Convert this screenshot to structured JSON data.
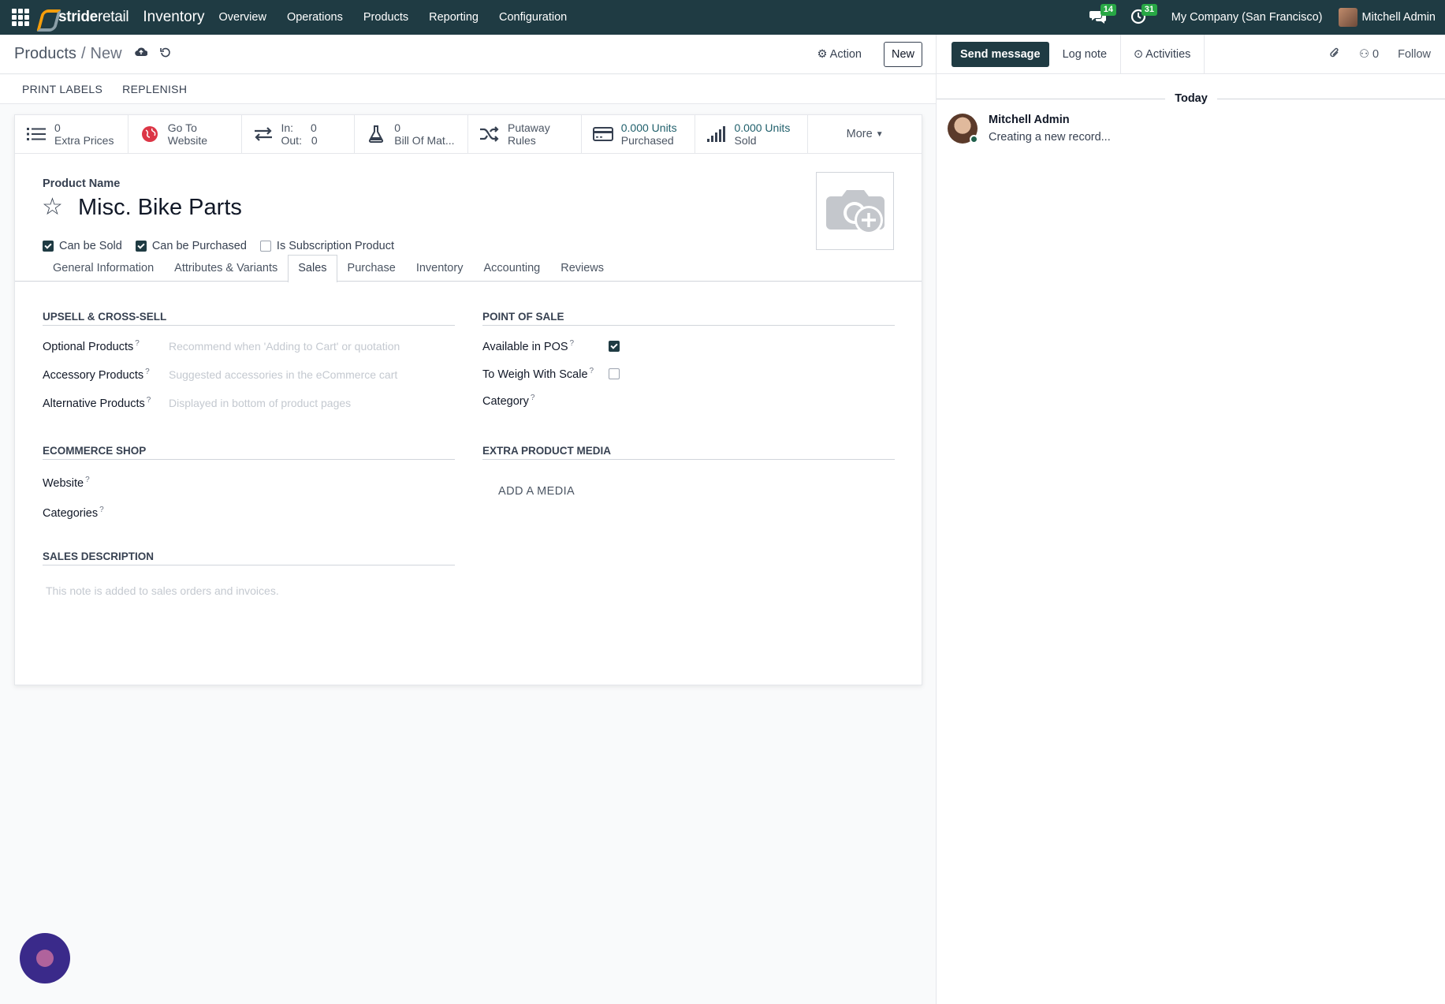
{
  "navbar": {
    "brand_part1": "stride",
    "brand_part2": "retail",
    "app_name": "Inventory",
    "menu": [
      "Overview",
      "Operations",
      "Products",
      "Reporting",
      "Configuration"
    ],
    "messages_count": "14",
    "activities_count": "31",
    "company": "My Company (San Francisco)",
    "user": "Mitchell Admin"
  },
  "control": {
    "breadcrumb_parent": "Products",
    "breadcrumb_sep": "/",
    "breadcrumb_current": "New",
    "action_label": "Action",
    "new_label": "New"
  },
  "status_buttons": [
    "PRINT LABELS",
    "REPLENISH"
  ],
  "smart_buttons": {
    "extra_prices": {
      "value": "0",
      "label": "Extra Prices"
    },
    "website": {
      "line1": "Go To",
      "line2": "Website"
    },
    "in_out": {
      "in_label": "In:",
      "in_value": "0",
      "out_label": "Out:",
      "out_value": "0"
    },
    "bom": {
      "value": "0",
      "label": "Bill Of Mat..."
    },
    "putaway": {
      "line1": "Putaway",
      "line2": "Rules"
    },
    "purchased": {
      "value": "0.000 Units",
      "label": "Purchased"
    },
    "sold": {
      "value": "0.000 Units",
      "label": "Sold"
    },
    "more": "More"
  },
  "form": {
    "product_name_label": "Product Name",
    "product_name": "Misc. Bike Parts",
    "can_be_sold": {
      "label": "Can be Sold",
      "checked": true
    },
    "can_be_purchased": {
      "label": "Can be Purchased",
      "checked": true
    },
    "is_subscription": {
      "label": "Is Subscription Product",
      "checked": false
    }
  },
  "tabs": [
    "General Information",
    "Attributes & Variants",
    "Sales",
    "Purchase",
    "Inventory",
    "Accounting",
    "Reviews"
  ],
  "active_tab": "Sales",
  "sales": {
    "upsell": {
      "title": "UPSELL & CROSS-SELL",
      "optional_label": "Optional Products",
      "optional_placeholder": "Recommend when 'Adding to Cart' or quotation",
      "accessory_label": "Accessory Products",
      "accessory_placeholder": "Suggested accessories in the eCommerce cart",
      "alternative_label": "Alternative Products",
      "alternative_placeholder": "Displayed in bottom of product pages"
    },
    "pos": {
      "title": "POINT OF SALE",
      "available_label": "Available in POS",
      "available_checked": true,
      "weigh_label": "To Weigh With Scale",
      "weigh_checked": false,
      "category_label": "Category"
    },
    "ecommerce": {
      "title": "ECOMMERCE SHOP",
      "website_label": "Website",
      "categories_label": "Categories"
    },
    "media": {
      "title": "EXTRA PRODUCT MEDIA",
      "add_label": "ADD A MEDIA"
    },
    "description": {
      "title": "SALES DESCRIPTION",
      "placeholder": "This note is added to sales orders and invoices."
    }
  },
  "chatter": {
    "send_message": "Send message",
    "log_note": "Log note",
    "activities": "Activities",
    "followers_count": "0",
    "follow": "Follow",
    "today": "Today",
    "message_author": "Mitchell Admin",
    "message_body": "Creating a new record..."
  },
  "colors": {
    "navbar": "#1f3b43",
    "primary": "#1f3b43",
    "badge": "#28a745",
    "fab": "#3a2a8a"
  }
}
